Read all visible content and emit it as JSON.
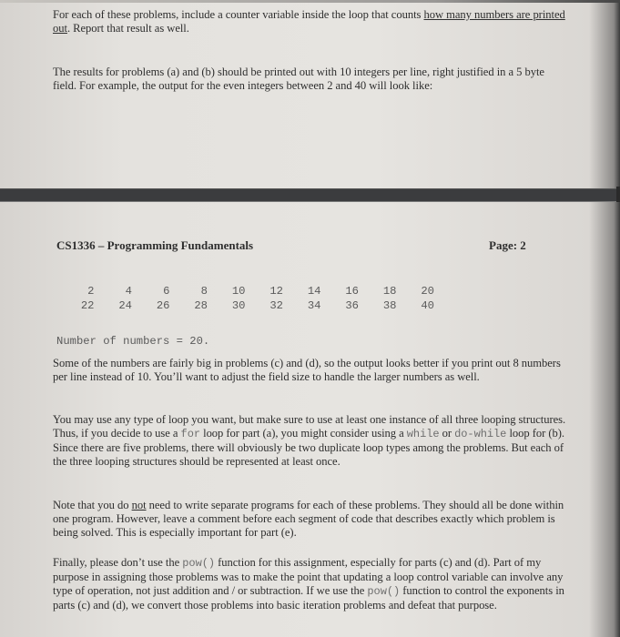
{
  "top_section": {
    "para1": {
      "text_before": "For each of these problems, include a counter variable inside the loop that counts ",
      "underlined": "how many numbers are printed out",
      "text_after": ". Report that result as well."
    },
    "para2": "The results for problems (a) and (b) should be printed out with 10 integers per line, right justified in a 5 byte field. For example, the output for the even integers between 2 and 40 will look like:"
  },
  "page_header": {
    "course": "CS1336 – Programming Fundamentals",
    "page_label": "Page: 2"
  },
  "sample_output": {
    "rows": [
      [
        "2",
        "4",
        "6",
        "8",
        "10",
        "12",
        "14",
        "16",
        "18",
        "20"
      ],
      [
        "22",
        "24",
        "26",
        "28",
        "30",
        "32",
        "34",
        "36",
        "38",
        "40"
      ]
    ],
    "count_line": "Number of numbers = 20."
  },
  "paragraphs": {
    "p3": "Some of the numbers are fairly big in problems (c) and (d), so the output looks better if you print out 8 numbers per line instead of 10. You’ll want to adjust the field size to handle the larger numbers as well.",
    "p4": {
      "t1": "You may use any type of loop you want, but make sure to use at least one instance of all three looping structures. Thus, if you decide to use a ",
      "code1": "for",
      "t2": " loop for part (a), you might consider using a ",
      "code2": "while",
      "t3": " or ",
      "code3": "do-while",
      "t4": " loop for (b). Since there are five problems, there will obviously be two duplicate loop types among the problems. But each of the three looping structures should be represented at least once."
    },
    "p5": {
      "t1": "Note that you do ",
      "underlined": "not",
      "t2": " need to write separate programs for each of these problems. They should all be done within one program. However, leave a comment before each segment of code that describes exactly which problem is being solved. This is especially important for part (e)."
    },
    "p6": {
      "t1": "Finally, please don’t use the ",
      "code1": "pow()",
      "t2": " function for this assignment, especially for parts (c) and (d). Part of my purpose in assigning those problems was to make the point that updating a loop control variable can involve any type of operation, not just addition and / or subtraction. If we use the ",
      "code2": "pow()",
      "t3": " function to control the exponents in parts (c) and (d), we convert those problems into basic iteration problems and defeat that purpose."
    }
  }
}
